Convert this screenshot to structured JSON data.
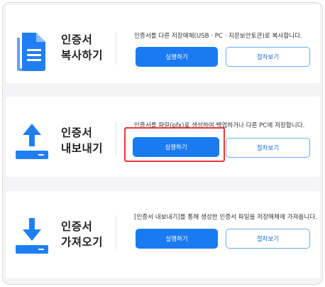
{
  "colors": {
    "primary": "#1a7bf0",
    "outline_border": "#6aa9f2",
    "icon_blue": "#1f7ff2",
    "highlight": "#e53838"
  },
  "sections": [
    {
      "icon": "copy-document-icon",
      "title_line1": "인증서",
      "title_line2": "복사하기",
      "description": "인증서를 다른 저장매체(USB · PC · 지문보안토큰)로 복사합니다.",
      "primary_label": "실행하기",
      "secondary_label": "절차보기"
    },
    {
      "icon": "upload-tray-icon",
      "title_line1": "인증서",
      "title_line2": "내보내기",
      "description": "인증서를 파일(pfx)로 생성하여 백업하거나 다른 PC에 저장합니다.",
      "primary_label": "실행하기",
      "secondary_label": "절차보기"
    },
    {
      "icon": "download-tray-icon",
      "title_line1": "인증서",
      "title_line2": "가져오기",
      "description": "[인증서 내보내기]를 통해 생성한 인증서 파일을 저장매체에 가져옵니다.",
      "primary_label": "실행하기",
      "secondary_label": "절차보기"
    }
  ]
}
